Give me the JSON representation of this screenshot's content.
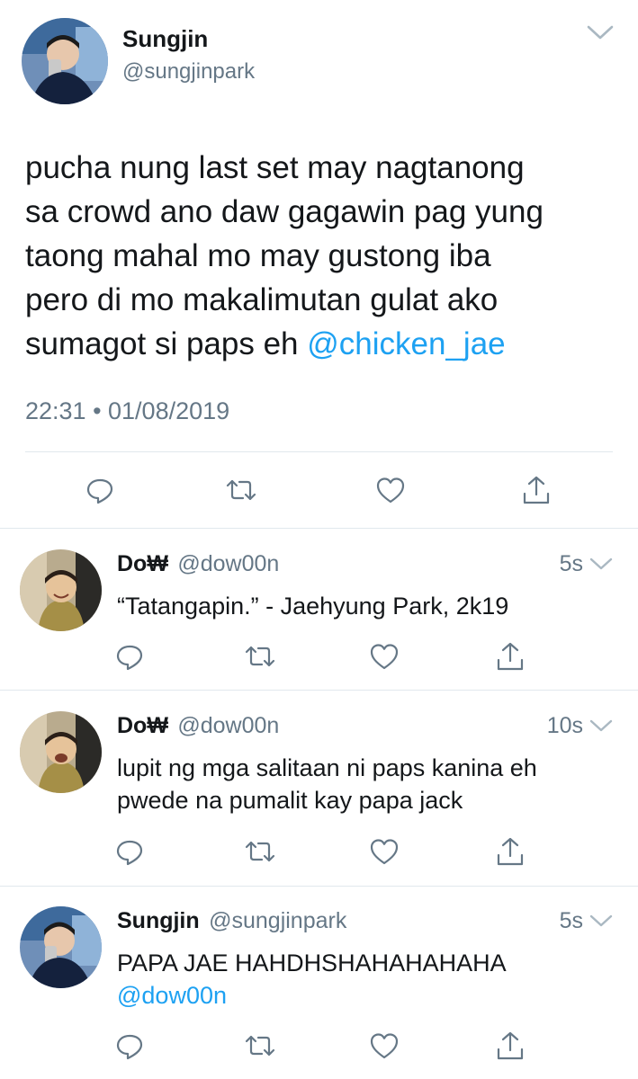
{
  "main_tweet": {
    "name": "Sungjin",
    "handle": "@sungjinpark",
    "text_lines": [
      "pucha nung last set may nagtanong",
      "sa crowd ano daw gagawin pag yung",
      "taong mahal mo may gustong iba",
      "pero di mo makalimutan gulat ako"
    ],
    "last_line_text": "sumagot si paps eh ",
    "mention": "@chicken_jae",
    "timestamp": "22:31 • 01/08/2019"
  },
  "replies": [
    {
      "name": "Do₩",
      "handle": "@dow00n",
      "time": "5s",
      "lines": [
        "“Tatangapin.” - Jaehyung Park, 2k19"
      ]
    },
    {
      "name": "Do₩",
      "handle": "@dow00n",
      "time": "10s",
      "lines": [
        "lupit ng mga salitaan ni paps kanina eh",
        "pwede na pumalit kay papa jack"
      ]
    },
    {
      "name": "Sungjin",
      "handle": "@sungjinpark",
      "time": "5s",
      "lines": [
        "PAPA JAE HAHDHSHAHAHAHAHA"
      ],
      "mention": "@dow00n"
    }
  ],
  "colors": {
    "link": "#1da1f2",
    "muted": "#657786",
    "text": "#14171a",
    "divider": "#e1e8ed"
  },
  "icons": [
    "reply-icon",
    "retweet-icon",
    "like-icon",
    "share-icon",
    "chevron-down-icon"
  ]
}
